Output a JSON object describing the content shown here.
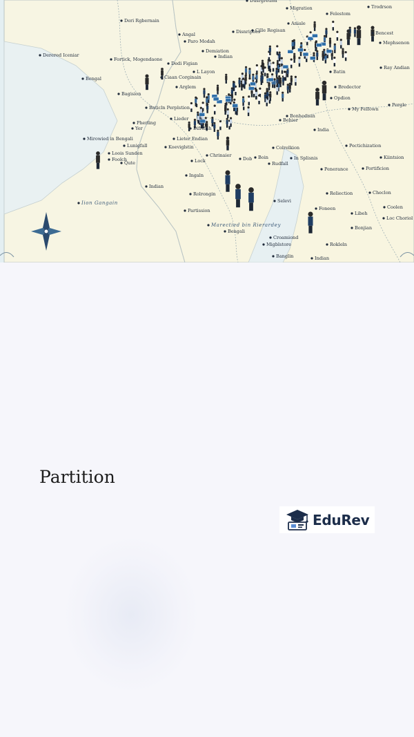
{
  "hero": {
    "alt": "Illustrated map of partition-era India with crowds of people",
    "labels": [
      "Dusrgretion",
      "Migration",
      "Felestom",
      "Trodrson",
      "Deri Rgbernain",
      "Cille Regisan",
      "Aniale",
      "Bencest",
      "Derered Iceniar",
      "Fortick, Mogendaone",
      "Disnripees",
      "Mephsenon",
      "Angal",
      "Paro Modah",
      "Demiation",
      "Indian",
      "Dedi Figian",
      "Ray Andian",
      "Bengal",
      "L Layon",
      "Batin",
      "Ciaan Corginain",
      "Arglem",
      "Bredector",
      "Bagision",
      "Opdion",
      "Pergle",
      "Bnticln Perplstion",
      "My Felfown",
      "Bonhedisin",
      "Pherling",
      "Lieder",
      "Behier",
      "Yer",
      "India",
      "Difrifish",
      "Mirowied in Bengali",
      "Lieter Endian",
      "Lunigfall",
      "Koeviglstin",
      "Colrelkion",
      "Pectichization",
      "Loois Sunden",
      "Chrinaier",
      "Dob",
      "Boin",
      "Kiintsion",
      "Foolch",
      "Qute",
      "Lock",
      "Rudfall",
      "In Splisnis",
      "Penerance",
      "Portificion",
      "Ingaln",
      "Indian",
      "Reliection",
      "Checlon",
      "Rolrongin",
      "Iion Gangain",
      "Selevi",
      "Foneen",
      "Coolen",
      "Libeh",
      "Partission",
      "Loc Choriol",
      "Marectied bin Rierardey",
      "Bengali",
      "Bonjian",
      "Croamiond",
      "Migblstore",
      "Rokleln",
      "Banglin",
      "Indian"
    ]
  },
  "section": {
    "title": "Partition"
  },
  "brand": {
    "name": "EduRev",
    "icon": "graduation-cap-laptop-icon",
    "color": "#1c2d4a"
  }
}
